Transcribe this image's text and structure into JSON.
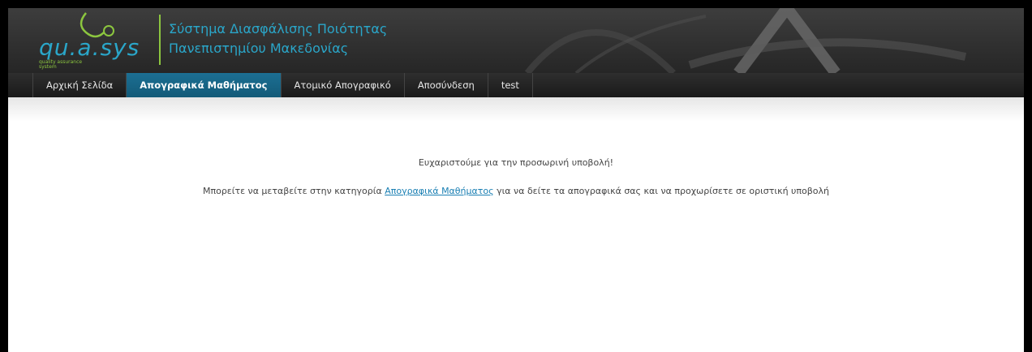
{
  "header": {
    "logo_text": "qu.a.sys",
    "logo_subtitle": "quality assurance system",
    "title_line1": "Σύστημα Διασφάλισης Ποιότητας",
    "title_line2": "Πανεπιστημίου Μακεδονίας"
  },
  "nav": {
    "items": [
      {
        "label": "Αρχική Σελίδα"
      },
      {
        "label": "Απογραφικά Μαθήματος"
      },
      {
        "label": "Ατομικό Απογραφικό"
      },
      {
        "label": "Αποσύνδεση"
      },
      {
        "label": "test"
      }
    ]
  },
  "content": {
    "thanks": "Ευχαριστούμε για την προσωρινή υποβολή!",
    "info_before": "Μπορείτε να μεταβείτε στην κατηγορία ",
    "info_link": "Απογραφικά Μαθήματος",
    "info_after": " για να δείτε τα απογραφικά σας και να προχωρίσετε σε οριστική υποβολή"
  },
  "colors": {
    "accent": "#2aa6c9",
    "active_tab": "#1c6f93",
    "logo_green": "#8cc63f"
  }
}
